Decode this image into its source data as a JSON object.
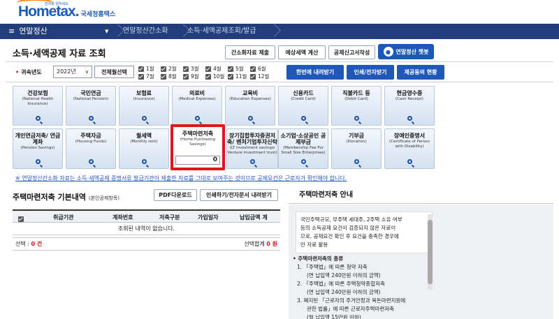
{
  "header": {
    "logo_main": "Hometax.",
    "logo_sub": "국세청홈택스",
    "logo_tiny": "전자로 일하세요"
  },
  "nav": {
    "menu_icon": "hamburger-icon",
    "menu_label": "연말정산",
    "crumbs": [
      "연말정산간소화",
      "소득·세액공제조회/발급"
    ]
  },
  "page": {
    "title": "소득·세액공제 자료 조회",
    "top_buttons": [
      "간소화자료 제출",
      "예상세액 계산",
      "공제신고서작성"
    ],
    "chat_label": "연말정산 챗봇"
  },
  "filter": {
    "year_label": "귀속년도",
    "year_value": "2022년",
    "select_all": "전체월선택",
    "months": [
      "1월",
      "2월",
      "3월",
      "4월",
      "5월",
      "6월",
      "7월",
      "8월",
      "9월",
      "10월",
      "11월",
      "12월"
    ],
    "action_buttons": [
      "한번에 내려받기",
      "인쇄/전자받기",
      "제공동의 현황"
    ]
  },
  "categories": [
    {
      "title": "건강보험",
      "en": "(National Health Insurance)"
    },
    {
      "title": "국민연금",
      "en": "(National Pension)"
    },
    {
      "title": "보험료",
      "en": "(Insurance)"
    },
    {
      "title": "의료비",
      "en": "(Medical Expenses)"
    },
    {
      "title": "교육비",
      "en": "(Education Expenses)"
    },
    {
      "title": "신용카드",
      "en": "(Credit Card)"
    },
    {
      "title": "직불카드 등",
      "en": "(Debit Card)"
    },
    {
      "title": "현금영수증",
      "en": "(Cash Receipt)"
    },
    {
      "title": "개인연금저축/ 연금계좌",
      "en": "(Pension Savings)"
    },
    {
      "title": "주택자금",
      "en": "(Housing Funds)"
    },
    {
      "title": "월세액",
      "en": "(Monthly rent)"
    },
    {
      "title": "주택마련저축",
      "en": "(Home Purchasing Savings)",
      "amount": "0"
    },
    {
      "title": "장기집합투자증권저축/ 벤처기업투자신탁",
      "en": "(LT investment savings/ Venture investment trust)"
    },
    {
      "title": "소기업·소상공인 공제부금",
      "en": "(Membership Fee For Small Size Enterprises)"
    },
    {
      "title": "기부금",
      "en": "(Donation)"
    },
    {
      "title": "장애인증명서",
      "en": "(Certificate of Person with Disability)"
    }
  ],
  "notice": "※ 연말정산간소화 자료는 소득·세액공제 증명서류 발급기관이 제출한 자료를 그대로 보여주는 것이므로 공제요건은 근로자가 확인해야 합니다.",
  "detail": {
    "title": "주택마련저축 기본내역",
    "title_note": "(본인공제항목)",
    "pdf_btn": "PDF다운로드",
    "print_btn": "인쇄하기/전자문서 내려받기",
    "columns": [
      "취급기관",
      "계좌번호",
      "저축구분",
      "가입일자",
      "납입금액 계"
    ],
    "empty_msg": "조회된 내역이 없습니다.",
    "select_label": "선택 :",
    "select_count": "0 건",
    "total_label": "선택합계",
    "total_value": "0 원"
  },
  "guide": {
    "title": "주택마련저축 안내",
    "box_lines": [
      "국민주택규모, 무주택 세대주, 2주택 소유 여부",
      "등의 소득공제 요건이 검증되지 않은 자료이",
      "므로, 공제요건 확인 후 요건을 충족한 경우에",
      "만 자료 활용"
    ],
    "section": "주택마련저축의 종류",
    "items": [
      "1. 「주택법」에 따른 청약 저축",
      "(연 납입액 240만원 이하의 금액)",
      "2. 「주택법」에 따른 주택청약종합저축",
      "(연 납입액 240만원 이하의 금액)",
      "3. 폐지된 「근로자의 주거안정과 목돈마련지원에",
      "관한 법률」에 따른 근로자주택마련저축",
      "(월 납입액 15만원 이하)"
    ]
  }
}
